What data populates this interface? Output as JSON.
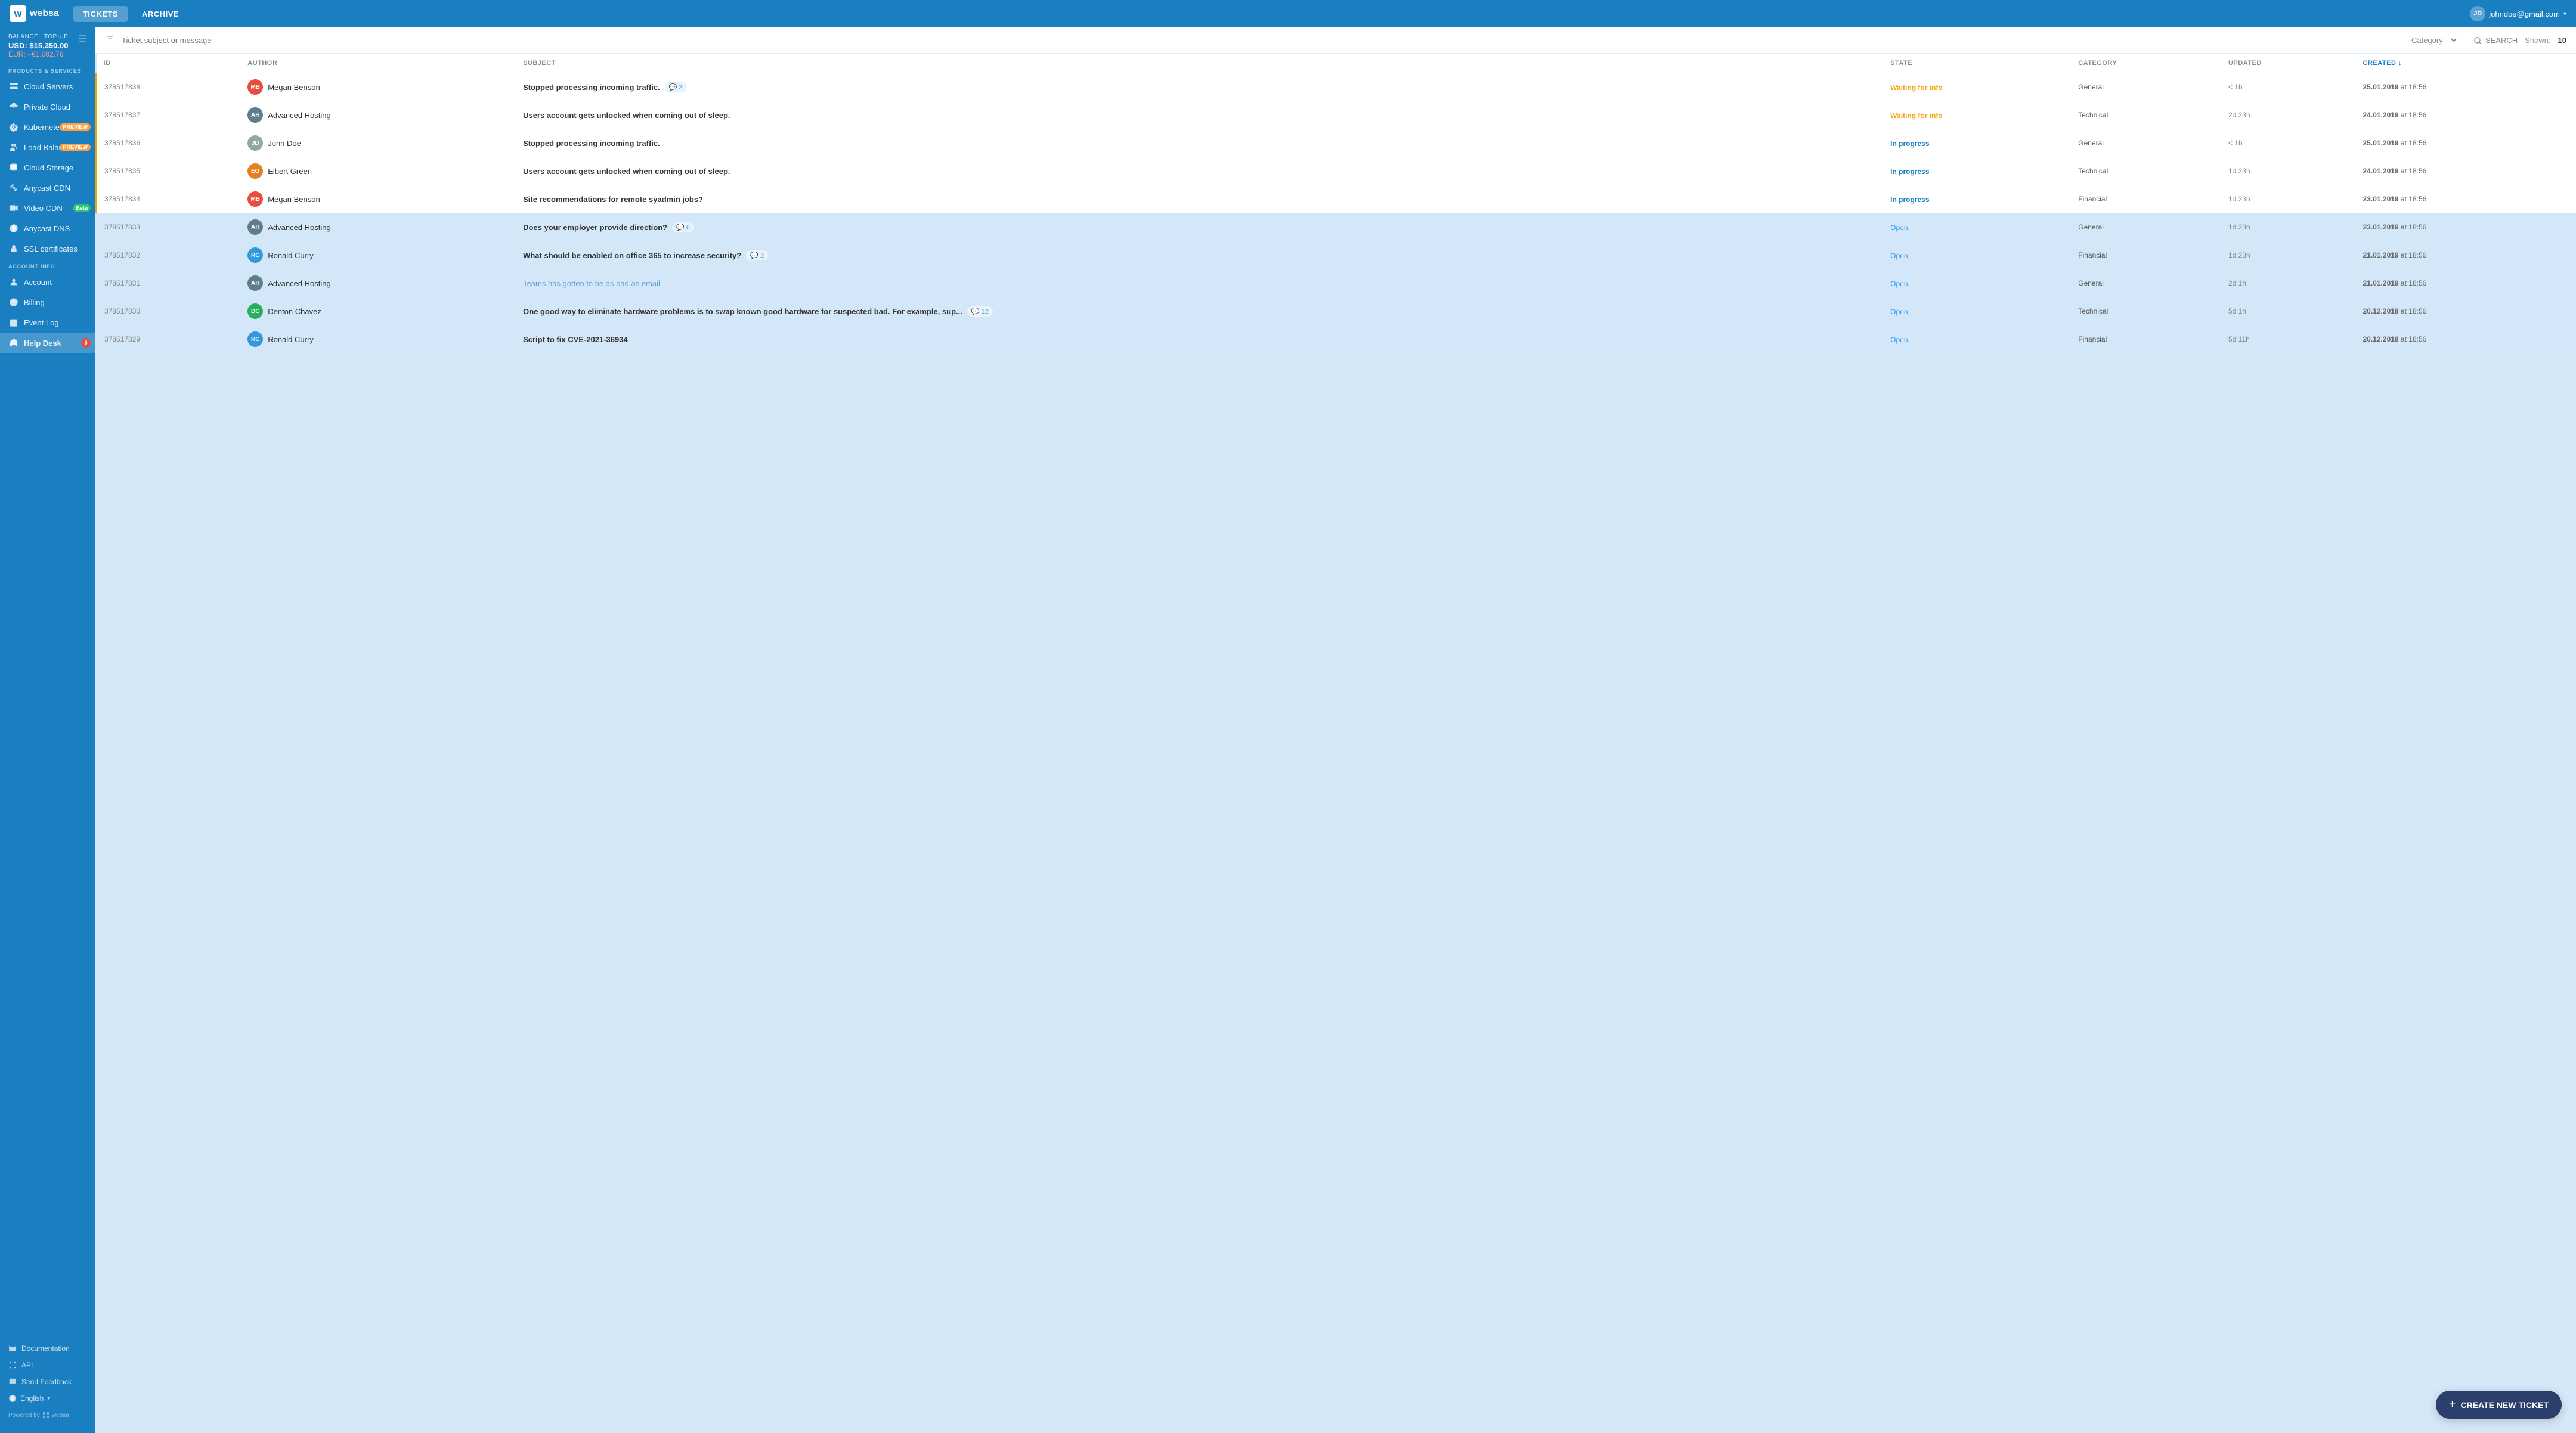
{
  "app": {
    "name": "websa"
  },
  "topnav": {
    "tabs": [
      {
        "id": "tickets",
        "label": "TICKETS",
        "active": true
      },
      {
        "id": "archive",
        "label": "ARCHIVE",
        "active": false
      }
    ],
    "user": {
      "email": "johndoe@gmail.com",
      "initials": "JD"
    }
  },
  "sidebar": {
    "balance": {
      "label": "BALANCE",
      "top_up": "TOP-UP",
      "usd": "USD: $15,350.00",
      "eur": "EUR: −€1,002.76"
    },
    "products_label": "PRODUCTS & SERVICES",
    "items": [
      {
        "id": "cloud-servers",
        "label": "Cloud Servers",
        "icon": "server"
      },
      {
        "id": "private-cloud",
        "label": "Private Cloud",
        "icon": "cloud-lock"
      },
      {
        "id": "kubernetes",
        "label": "Kubernetes",
        "icon": "gear",
        "badge": "PREVIEW"
      },
      {
        "id": "load-balancers",
        "label": "Load Balancers",
        "icon": "users",
        "badge": "PREVIEW"
      },
      {
        "id": "cloud-storage",
        "label": "Cloud Storage",
        "icon": "database"
      },
      {
        "id": "anycast-cdn",
        "label": "Anycast CDN",
        "icon": "broadcast"
      },
      {
        "id": "video-cdn",
        "label": "Video CDN",
        "icon": "video",
        "badge": "Beta"
      },
      {
        "id": "anycast-dns",
        "label": "Anycast DNS",
        "icon": "dns"
      },
      {
        "id": "ssl-certificates",
        "label": "SSL certificates",
        "icon": "lock"
      }
    ],
    "account_label": "ACCOUNT INFO",
    "account_items": [
      {
        "id": "account",
        "label": "Account",
        "icon": "person"
      },
      {
        "id": "billing",
        "label": "Billing",
        "icon": "dollar"
      },
      {
        "id": "event-log",
        "label": "Event Log",
        "icon": "calendar"
      },
      {
        "id": "help-desk",
        "label": "Help Desk",
        "icon": "headset",
        "badge_num": "5",
        "active": true
      }
    ],
    "footer_links": [
      {
        "id": "documentation",
        "label": "Documentation",
        "icon": "book"
      },
      {
        "id": "api",
        "label": "API",
        "icon": "code"
      },
      {
        "id": "send-feedback",
        "label": "Send Feedback",
        "icon": "chat"
      }
    ],
    "language": "English",
    "powered_by": "Powered by",
    "powered_brand": "websa"
  },
  "toolbar": {
    "search_placeholder": "Ticket subject or message",
    "category_label": "Category",
    "search_label": "SEARCH",
    "shown_label": "Shown:",
    "shown_count": "10"
  },
  "table": {
    "columns": [
      "ID",
      "Author",
      "Subject",
      "State",
      "Category",
      "Updated",
      "Created"
    ],
    "rows": [
      {
        "id": "378517838",
        "author": "Megan Benson",
        "author_initials": "MB",
        "author_color": "#e74c3c",
        "subject": "Stopped processing incoming traffic.",
        "comments": 3,
        "state": "Waiting for info",
        "state_type": "waiting",
        "category": "General",
        "updated": "< 1h",
        "created_date": "25.01.2019",
        "created_time": "18:56",
        "highlighted": true
      },
      {
        "id": "378517837",
        "author": "Advanced Hosting",
        "author_initials": "AH",
        "author_color": "#607d8b",
        "subject": "Users account gets unlocked when coming out of sleep.",
        "comments": 0,
        "state": "Waiting for info",
        "state_type": "waiting",
        "category": "Technical",
        "updated": "2d 23h",
        "created_date": "24.01.2019",
        "created_time": "18:56",
        "highlighted": true
      },
      {
        "id": "378517836",
        "author": "John Doe",
        "author_initials": "JD",
        "author_color": "#95a5a6",
        "subject": "Stopped processing incoming traffic.",
        "comments": 0,
        "state": "In progress",
        "state_type": "progress",
        "category": "General",
        "updated": "< 1h",
        "created_date": "25.01.2019",
        "created_time": "18:56",
        "highlighted": true
      },
      {
        "id": "378517835",
        "author": "Elbert Green",
        "author_initials": "EG",
        "author_color": "#e67e22",
        "subject": "Users account gets unlocked when coming out of sleep.",
        "comments": 0,
        "state": "In progress",
        "state_type": "progress",
        "category": "Technical",
        "updated": "1d 23h",
        "created_date": "24.01.2019",
        "created_time": "18:56",
        "highlighted": true
      },
      {
        "id": "378517834",
        "author": "Megan Benson",
        "author_initials": "MB",
        "author_color": "#e74c3c",
        "subject": "Site recommendations for remote syadmin jobs?",
        "comments": 0,
        "state": "In progress",
        "state_type": "progress",
        "category": "Financial",
        "updated": "1d 23h",
        "created_date": "23.01.2019",
        "created_time": "18:56",
        "highlighted": true
      },
      {
        "id": "378517833",
        "author": "Advanced Hosting",
        "author_initials": "AH",
        "author_color": "#607d8b",
        "subject": "Does your employer provide direction?",
        "comments": 6,
        "state": "Open",
        "state_type": "open",
        "category": "General",
        "updated": "1d 23h",
        "created_date": "23.01.2019",
        "created_time": "18:56",
        "highlighted": false
      },
      {
        "id": "378517832",
        "author": "Ronald Curry",
        "author_initials": "RC",
        "author_color": "#3498db",
        "subject": "What should be enabled on office 365 to increase security?",
        "comments": 2,
        "state": "Open",
        "state_type": "open",
        "category": "Financial",
        "updated": "1d 23h",
        "created_date": "21.01.2019",
        "created_time": "18:56",
        "highlighted": false
      },
      {
        "id": "378517831",
        "author": "Advanced Hosting",
        "author_initials": "AH",
        "author_color": "#607d8b",
        "subject": "Teams has gotten to be as bad as email",
        "comments": 0,
        "state": "Open",
        "state_type": "open",
        "category": "General",
        "updated": "2d 1h",
        "created_date": "21.01.2019",
        "created_time": "18:56",
        "highlighted": false,
        "subject_link": true
      },
      {
        "id": "378517830",
        "author": "Denton Chavez",
        "author_initials": "DC",
        "author_color": "#27ae60",
        "subject": "One good way to eliminate hardware problems is to swap known good hardware for suspected bad. For example, sup...",
        "comments": 12,
        "state": "Open",
        "state_type": "open",
        "category": "Technical",
        "updated": "5d 1h",
        "created_date": "20.12.2018",
        "created_time": "18:56",
        "highlighted": false
      },
      {
        "id": "378517829",
        "author": "Ronald Curry",
        "author_initials": "RC",
        "author_color": "#3498db",
        "subject": "Script to fix CVE-2021-36934",
        "comments": 0,
        "state": "Open",
        "state_type": "open",
        "category": "Financial",
        "updated": "5d 11h",
        "created_date": "20.12.2018",
        "created_time": "18:56",
        "highlighted": false
      }
    ]
  },
  "create_button": {
    "label": "CREATE NEW TICKET"
  }
}
